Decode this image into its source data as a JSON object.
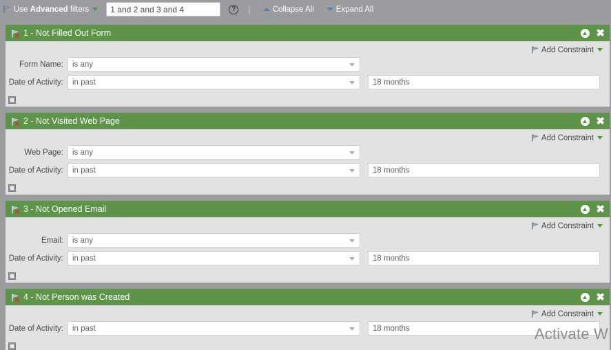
{
  "toolbar": {
    "advanced_filters_prefix": "Use ",
    "advanced_filters_bold": "Advanced",
    "advanced_filters_suffix": " filters",
    "filter_expression": "1 and 2 and 3 and 4",
    "filter_placeholder": "1 and 2 and 3 and 4",
    "help_glyph": "?",
    "divider": "|",
    "collapse_all": "Collapse All",
    "expand_all": "Expand All"
  },
  "common": {
    "add_constraint": "Add Constraint",
    "close_glyph": "✖",
    "date_of_activity_label": "Date of Activity:",
    "in_past": "in past",
    "is_any": "is any",
    "months_18": "18 months"
  },
  "panels": [
    {
      "title": "1 - Not Filled Out Form",
      "add_constraint": "Add Constraint",
      "fields": [
        {
          "label": "Form Name:",
          "select_value": "is any",
          "value_box": null
        },
        {
          "label": "Date of Activity:",
          "select_value": "in past",
          "value_box": "18 months"
        }
      ]
    },
    {
      "title": "2 - Not Visited Web Page",
      "add_constraint": "Add Constraint",
      "fields": [
        {
          "label": "Web Page:",
          "select_value": "is any",
          "value_box": null
        },
        {
          "label": "Date of Activity:",
          "select_value": "in past",
          "value_box": "18 months"
        }
      ]
    },
    {
      "title": "3 - Not Opened Email",
      "add_constraint": "Add Constraint",
      "fields": [
        {
          "label": "Email:",
          "select_value": "is any",
          "value_box": null
        },
        {
          "label": "Date of Activity:",
          "select_value": "in past",
          "value_box": "18 months"
        }
      ]
    },
    {
      "title": "4 - Not Person was Created",
      "add_constraint": "Add Constraint",
      "fields": [
        {
          "label": "Date of Activity:",
          "select_value": "in past",
          "value_box": "18 months"
        }
      ]
    }
  ],
  "watermark": "Activate W",
  "colors": {
    "panel_header_green": "#5d9449",
    "toolbar_grey": "#9b9c9f",
    "panel_body": "#e2e2e2",
    "caret_green": "#4f9c3f",
    "triangle_blue": "#4a87b8"
  }
}
